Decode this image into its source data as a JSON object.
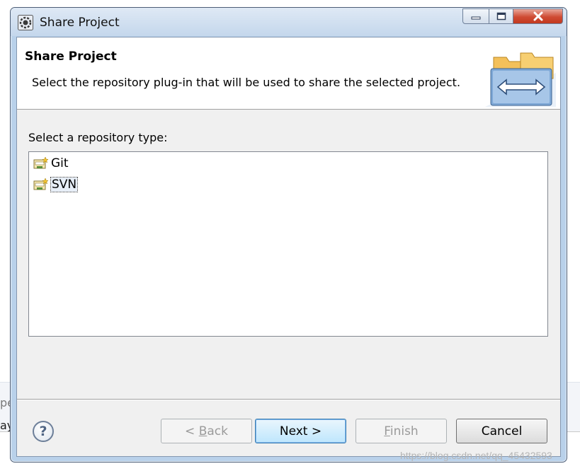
{
  "window": {
    "title": "Share Project"
  },
  "header": {
    "title": "Share Project",
    "description": "Select the repository plug-in that will be used to share the selected project."
  },
  "prompt": "Select a repository type:",
  "repository_types": [
    {
      "label": "Git",
      "selected": false,
      "icon": "git-repository-icon"
    },
    {
      "label": "SVN",
      "selected": true,
      "icon": "svn-repository-icon"
    }
  ],
  "buttons": {
    "back": {
      "pre": "< ",
      "mnemonic": "B",
      "rest": "ack",
      "enabled": false
    },
    "next": {
      "label": "Next >",
      "enabled": true
    },
    "finish": {
      "mnemonic": "F",
      "rest": "inish",
      "enabled": false
    },
    "cancel": {
      "label": "Cancel",
      "enabled": true
    }
  },
  "help_icon": "help-icon",
  "background_fragments": [
    "pe",
    "ay"
  ],
  "watermark": "https://blog.csdn.net/qq_45432593",
  "colors": {
    "title_bar": "#c4d7ec",
    "close_button": "#cf4b33",
    "default_button": "#bee6fd"
  }
}
